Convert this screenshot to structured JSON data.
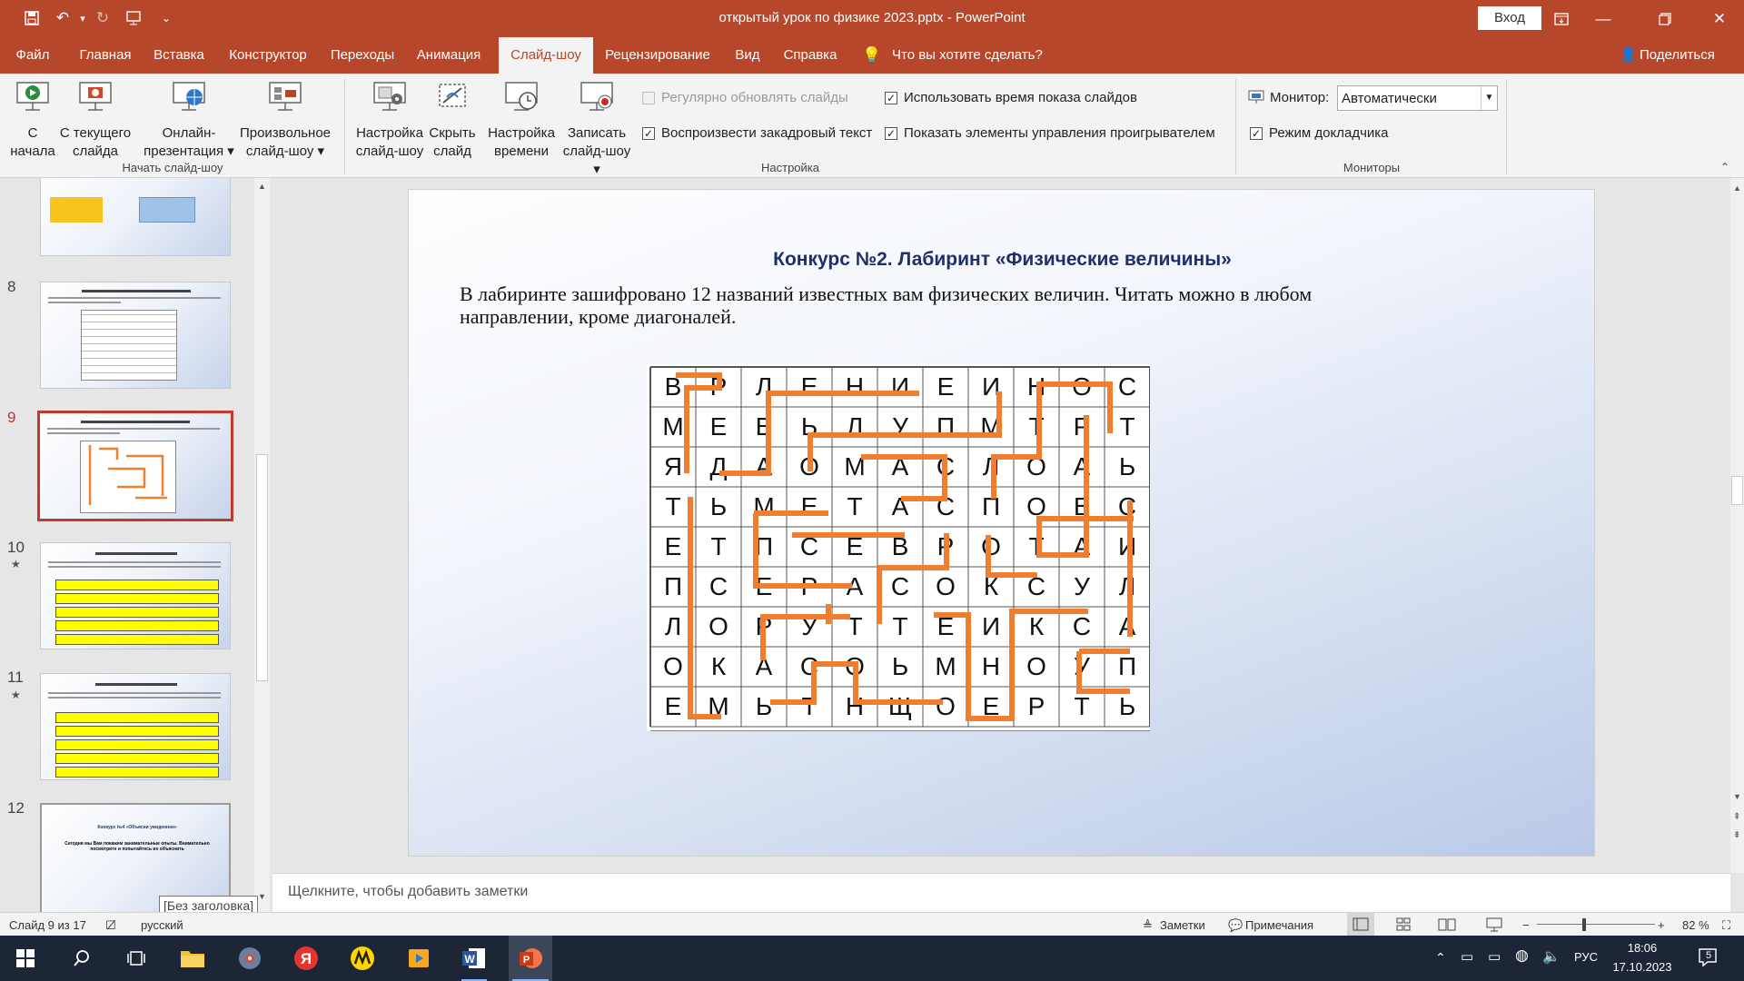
{
  "titlebar": {
    "title": "открытый урок по физике 2023.pptx  -  PowerPoint",
    "signin": "Вход"
  },
  "tabs": [
    "Файл",
    "Главная",
    "Вставка",
    "Конструктор",
    "Переходы",
    "Анимация",
    "Слайд-шоу",
    "Рецензирование",
    "Вид",
    "Справка"
  ],
  "tell_me": "Что вы хотите сделать?",
  "share": "Поделиться",
  "ribbon": {
    "from_start": [
      "С",
      "начала"
    ],
    "from_current": [
      "С текущего",
      "слайда"
    ],
    "online": [
      "Онлайн-",
      "презентация ▾"
    ],
    "custom": [
      "Произвольное",
      "слайд-шоу ▾"
    ],
    "group_start": "Начать слайд-шоу",
    "setup": [
      "Настройка",
      "слайд-шоу"
    ],
    "hide": [
      "Скрыть",
      "слайд"
    ],
    "timing": [
      "Настройка",
      "времени"
    ],
    "record": [
      "Записать",
      "слайд-шоу ▾"
    ],
    "cb_refresh": "Регулярно обновлять слайды",
    "cb_narration": "Воспроизвести закадровый текст",
    "cb_timings": "Использовать время показа слайдов",
    "cb_controls": "Показать элементы управления проигрывателем",
    "group_setup": "Настройка",
    "monitor_label": "Монитор:",
    "monitor_value": "Автоматически",
    "cb_presenter": "Режим докладчика",
    "group_monitors": "Мониторы"
  },
  "thumbs": {
    "numbers": [
      "8",
      "9",
      "10",
      "11",
      "12"
    ],
    "tooltip": "[Без заголовка]",
    "slide12_title": "Конкурс №4 «Объясни увиденное»",
    "slide12_text": "Сегодня мы Вам покажем занимательные опыты. Внимательно посмотрите и попытайтесь их объяснить"
  },
  "slide": {
    "title": "Конкурс №2. Лабиринт «Физические величины»",
    "text_line1": "В лабиринте зашифровано 12 названий известных вам физических величин. Читать можно в любом",
    "text_line2": "направлении,  кроме диагоналей.",
    "grid": [
      [
        "В",
        "Р",
        "Л",
        "Е",
        "Н",
        "И",
        "Е",
        "И",
        "Н",
        "О",
        "С"
      ],
      [
        "М",
        "Е",
        "В",
        "Ь",
        "Л",
        "У",
        "П",
        "М",
        "Т",
        "Р",
        "Т"
      ],
      [
        "Я",
        "Д",
        "А",
        "О",
        "М",
        "А",
        "С",
        "Л",
        "О",
        "А",
        "Ь"
      ],
      [
        "Т",
        "Ь",
        "М",
        "Е",
        "Т",
        "А",
        "С",
        "П",
        "О",
        "Б",
        "С"
      ],
      [
        "Е",
        "Т",
        "П",
        "С",
        "Е",
        "В",
        "Р",
        "О",
        "Т",
        "А",
        "И"
      ],
      [
        "П",
        "С",
        "Е",
        "Р",
        "А",
        "С",
        "О",
        "К",
        "С",
        "У",
        "Л"
      ],
      [
        "Л",
        "О",
        "Р",
        "У",
        "Т",
        "Т",
        "Е",
        "И",
        "К",
        "С",
        "А"
      ],
      [
        "О",
        "К",
        "А",
        "С",
        "О",
        "Ь",
        "М",
        "Н",
        "О",
        "У",
        "П"
      ],
      [
        "Е",
        "М",
        "Ь",
        "Т",
        "Н",
        "Щ",
        "О",
        "Е",
        "Р",
        "Т",
        "Ь"
      ]
    ]
  },
  "notes_placeholder": "Щелкните, чтобы добавить заметки",
  "status": {
    "slide_of": "Слайд 9 из 17",
    "language": "русский",
    "notes": "Заметки",
    "comments": "Примечания",
    "zoom": "82 %"
  },
  "taskbar": {
    "lang": "РУС",
    "time": "18:06",
    "date": "17.10.2023",
    "notif": "5"
  }
}
